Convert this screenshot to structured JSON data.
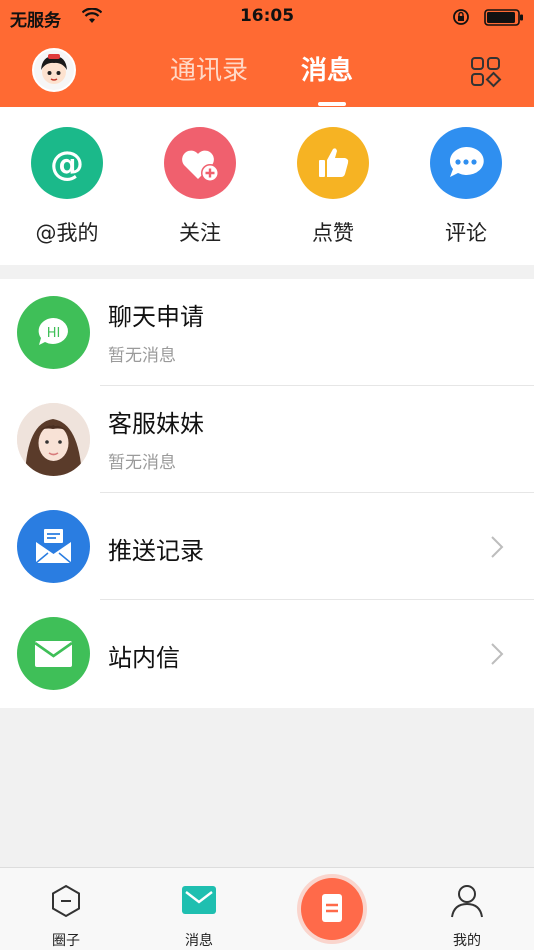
{
  "status": {
    "carrier": "无服务",
    "time": "16:05"
  },
  "header": {
    "tab_contacts": "通讯录",
    "tab_messages": "消息"
  },
  "quick_actions": [
    {
      "label": "@我的",
      "icon": "at-icon",
      "color": "#1bb98a"
    },
    {
      "label": "关注",
      "icon": "heart-plus-icon",
      "color": "#f0606e"
    },
    {
      "label": "点赞",
      "icon": "thumbs-up-icon",
      "color": "#f6b323"
    },
    {
      "label": "评论",
      "icon": "comment-icon",
      "color": "#2f8ff0"
    }
  ],
  "list": [
    {
      "title": "聊天申请",
      "subtitle": "暂无消息",
      "icon": "hi-chat-icon",
      "color": "#3fbf58"
    },
    {
      "title": "客服妹妹",
      "subtitle": "暂无消息",
      "icon": "customer-service-avatar"
    },
    {
      "title": "推送记录",
      "icon": "push-record-icon",
      "color": "#2a7de1"
    },
    {
      "title": "站内信",
      "icon": "mail-icon",
      "color": "#3fbf58"
    }
  ],
  "tabbar": {
    "circle": "圈子",
    "messages": "消息",
    "mine": "我的"
  },
  "colors": {
    "brand": "#ff6a33",
    "accent": "#1fbfb0"
  }
}
